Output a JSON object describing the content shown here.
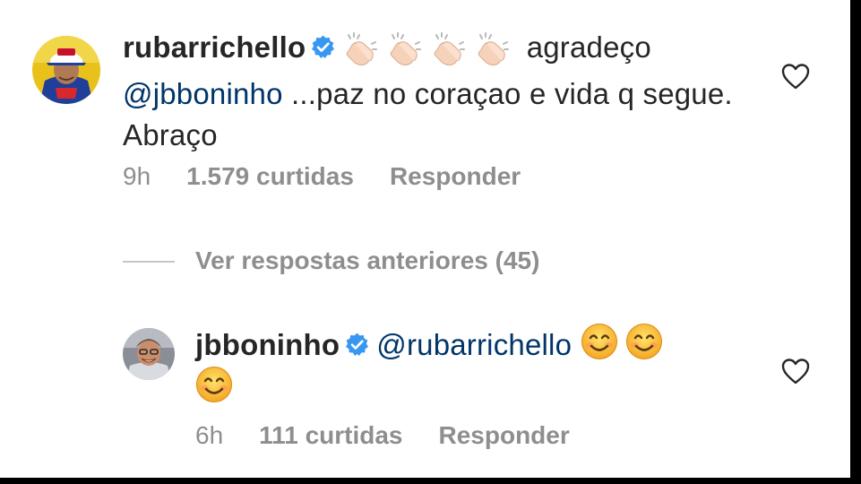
{
  "comments": [
    {
      "username": "rubarrichello",
      "verified": true,
      "emojis": [
        "clapping-hands",
        "clapping-hands",
        "clapping-hands",
        "clapping-hands"
      ],
      "text_before_mention": "agradeço",
      "mention": "@jbboninho",
      "text_after_mention": "...paz no coraçao e vida q segue. Abraço",
      "time": "9h",
      "likes": "1.579 curtidas",
      "reply_label": "Responder",
      "liked": false
    },
    {
      "username": "jbboninho",
      "verified": true,
      "mention": "@rubarrichello",
      "emojis": [
        "smiling-face",
        "smiling-face",
        "smiling-face"
      ],
      "time": "6h",
      "likes": "111 curtidas",
      "reply_label": "Responder",
      "liked": false
    }
  ],
  "view_replies": {
    "label": "Ver respostas anteriores (45)"
  },
  "colors": {
    "text": "#262626",
    "mention": "#003569",
    "muted": "#8e8e8e",
    "verified_blue": "#3897f0"
  }
}
